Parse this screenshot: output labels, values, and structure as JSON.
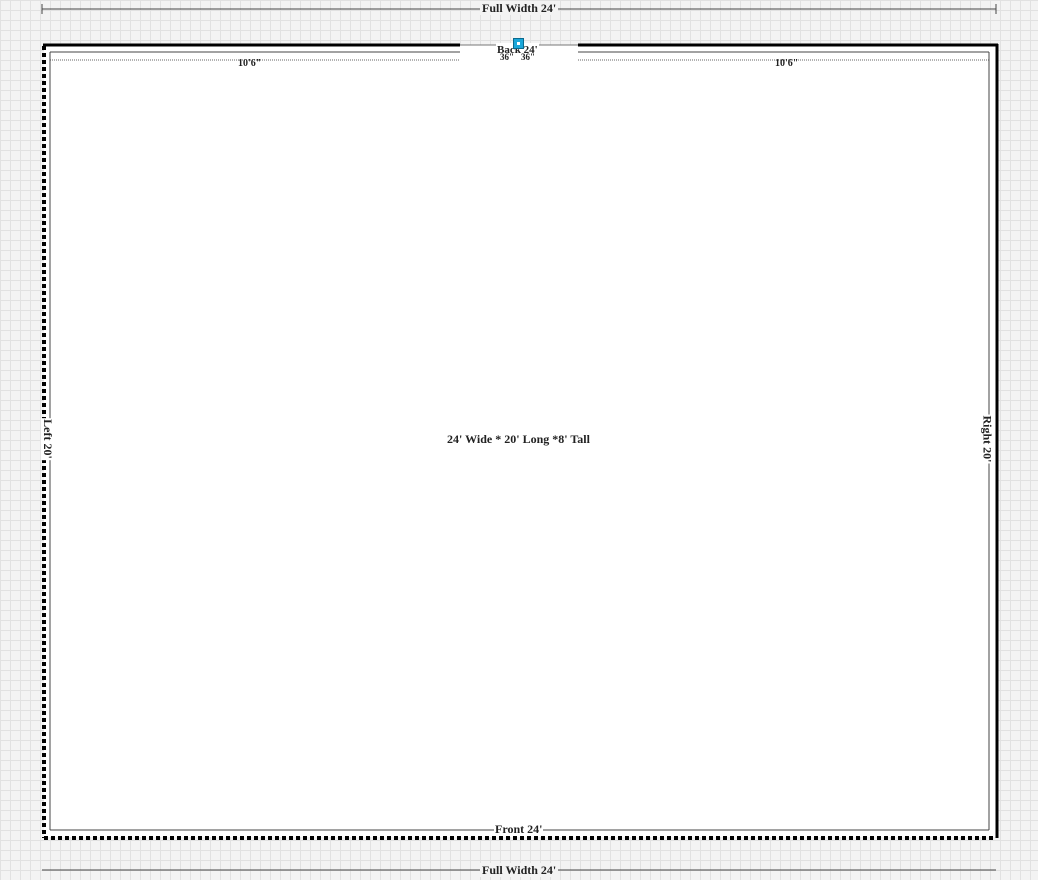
{
  "plan": {
    "summary": "24' Wide * 20' Long *8' Tall",
    "dimensions": {
      "full_width_top": "Full Width 24'",
      "full_width_bottom": "Full Width 24'",
      "front": "Front 24'",
      "left": "Left 20'",
      "right": "Right 20'",
      "back": "Back 24'"
    },
    "back_segments": {
      "left": "10'6\"",
      "right": "10'6\"",
      "opening_left": "36\"",
      "opening_right": "36\"",
      "opening_mid": "3'"
    }
  },
  "colors": {
    "grid": "#e1e1e1",
    "wall": "#000000",
    "selection": "#1aa6d9"
  }
}
